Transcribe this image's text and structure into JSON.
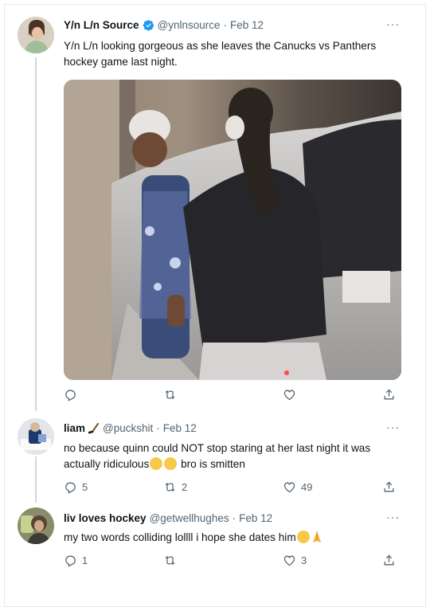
{
  "tweets": [
    {
      "name": "Y/n L/n Source",
      "handle": "@ynlnsource",
      "date": "Feb 12",
      "text": "Y/n L/n looking gorgeous as she leaves the Canucks vs Panthers hockey game last night.",
      "verified": true,
      "replies": "",
      "retweets": "",
      "likes": ""
    },
    {
      "name": "liam",
      "handle": "@puckshit",
      "date": "Feb 12",
      "text_before": "no because quinn could NOT stop staring at her last night it was actually ridiculous",
      "text_after": " bro is smitten",
      "replies": "5",
      "retweets": "2",
      "likes": "49"
    },
    {
      "name": "liv loves hockey",
      "handle": "@getwellhughes",
      "date": "Feb 12",
      "text_before": "my two words colliding lollll i hope she dates him",
      "replies": "1",
      "retweets": "",
      "likes": "3"
    }
  ],
  "separator": "·",
  "more": "···",
  "icons": {
    "reply": "reply-icon",
    "retweet": "retweet-icon",
    "like": "heart-icon",
    "share": "share-icon",
    "verified": "verified-badge-icon",
    "name_emoji": "hockey-stick-emoji",
    "emoji_cry": "loudly-crying-face-emoji",
    "emoji_pray": "folded-hands-emoji"
  },
  "colors": {
    "text": "#0f1419",
    "secondary": "#536471",
    "verified": "#1d9bf0",
    "thread_line": "#cfd9de"
  }
}
